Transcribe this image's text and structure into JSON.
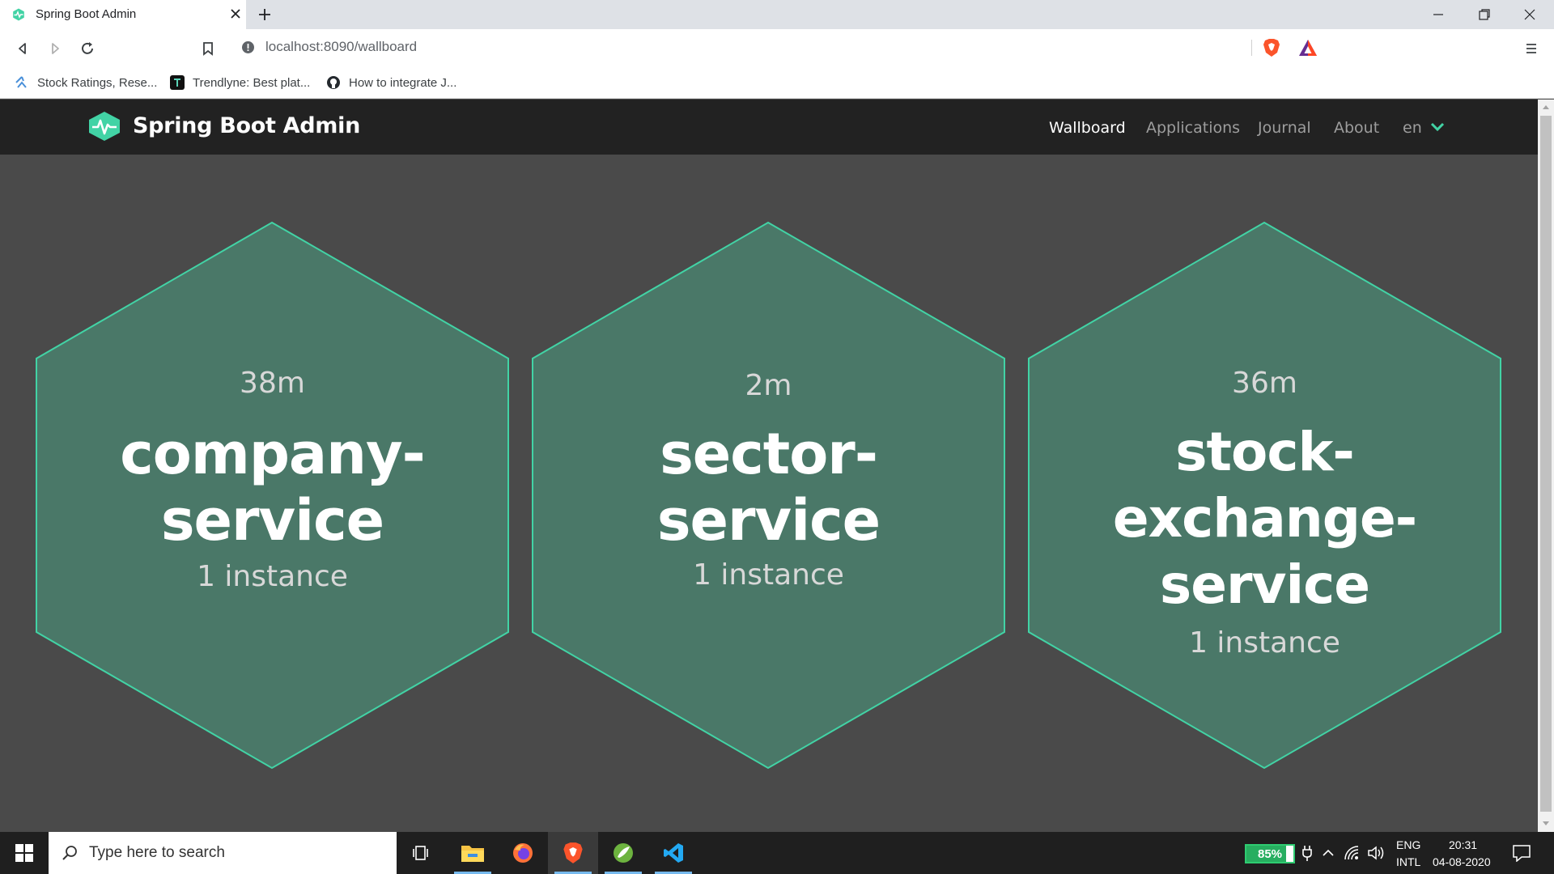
{
  "browser": {
    "tab_title": "Spring Boot Admin",
    "url": "localhost:8090/wallboard",
    "bookmarks": [
      {
        "label": "Stock Ratings, Rese..."
      },
      {
        "label": "Trendlyne: Best plat..."
      },
      {
        "label": "How to integrate J..."
      }
    ]
  },
  "navbar": {
    "brand": "Spring Boot Admin",
    "items": [
      {
        "label": "Wallboard",
        "active": true
      },
      {
        "label": "Applications",
        "active": false
      },
      {
        "label": "Journal",
        "active": false
      },
      {
        "label": "About",
        "active": false
      }
    ],
    "language": "en"
  },
  "wallboard": {
    "applications": [
      {
        "uptime": "38m",
        "name_lines": [
          "company-",
          "service"
        ],
        "instances": "1 instance",
        "status": "UP"
      },
      {
        "uptime": "2m",
        "name_lines": [
          "sector-",
          "service"
        ],
        "instances": "1 instance",
        "status": "UP"
      },
      {
        "uptime": "36m",
        "name_lines": [
          "stock-exchange-",
          "service"
        ],
        "instances": "1 instance",
        "status": "UP"
      }
    ]
  },
  "taskbar": {
    "search_placeholder": "Type here to search",
    "battery_percent": 85,
    "battery_label": "85%",
    "language_top": "ENG",
    "language_bottom": "INTL",
    "time": "20:31",
    "date": "04-08-2020"
  },
  "colors": {
    "hex_fill": "#4a7868",
    "hex_stroke": "#42d3a5",
    "navbar_bg": "#222222",
    "page_bg": "#4a4a4a",
    "brand_accent": "#42d3a5"
  }
}
